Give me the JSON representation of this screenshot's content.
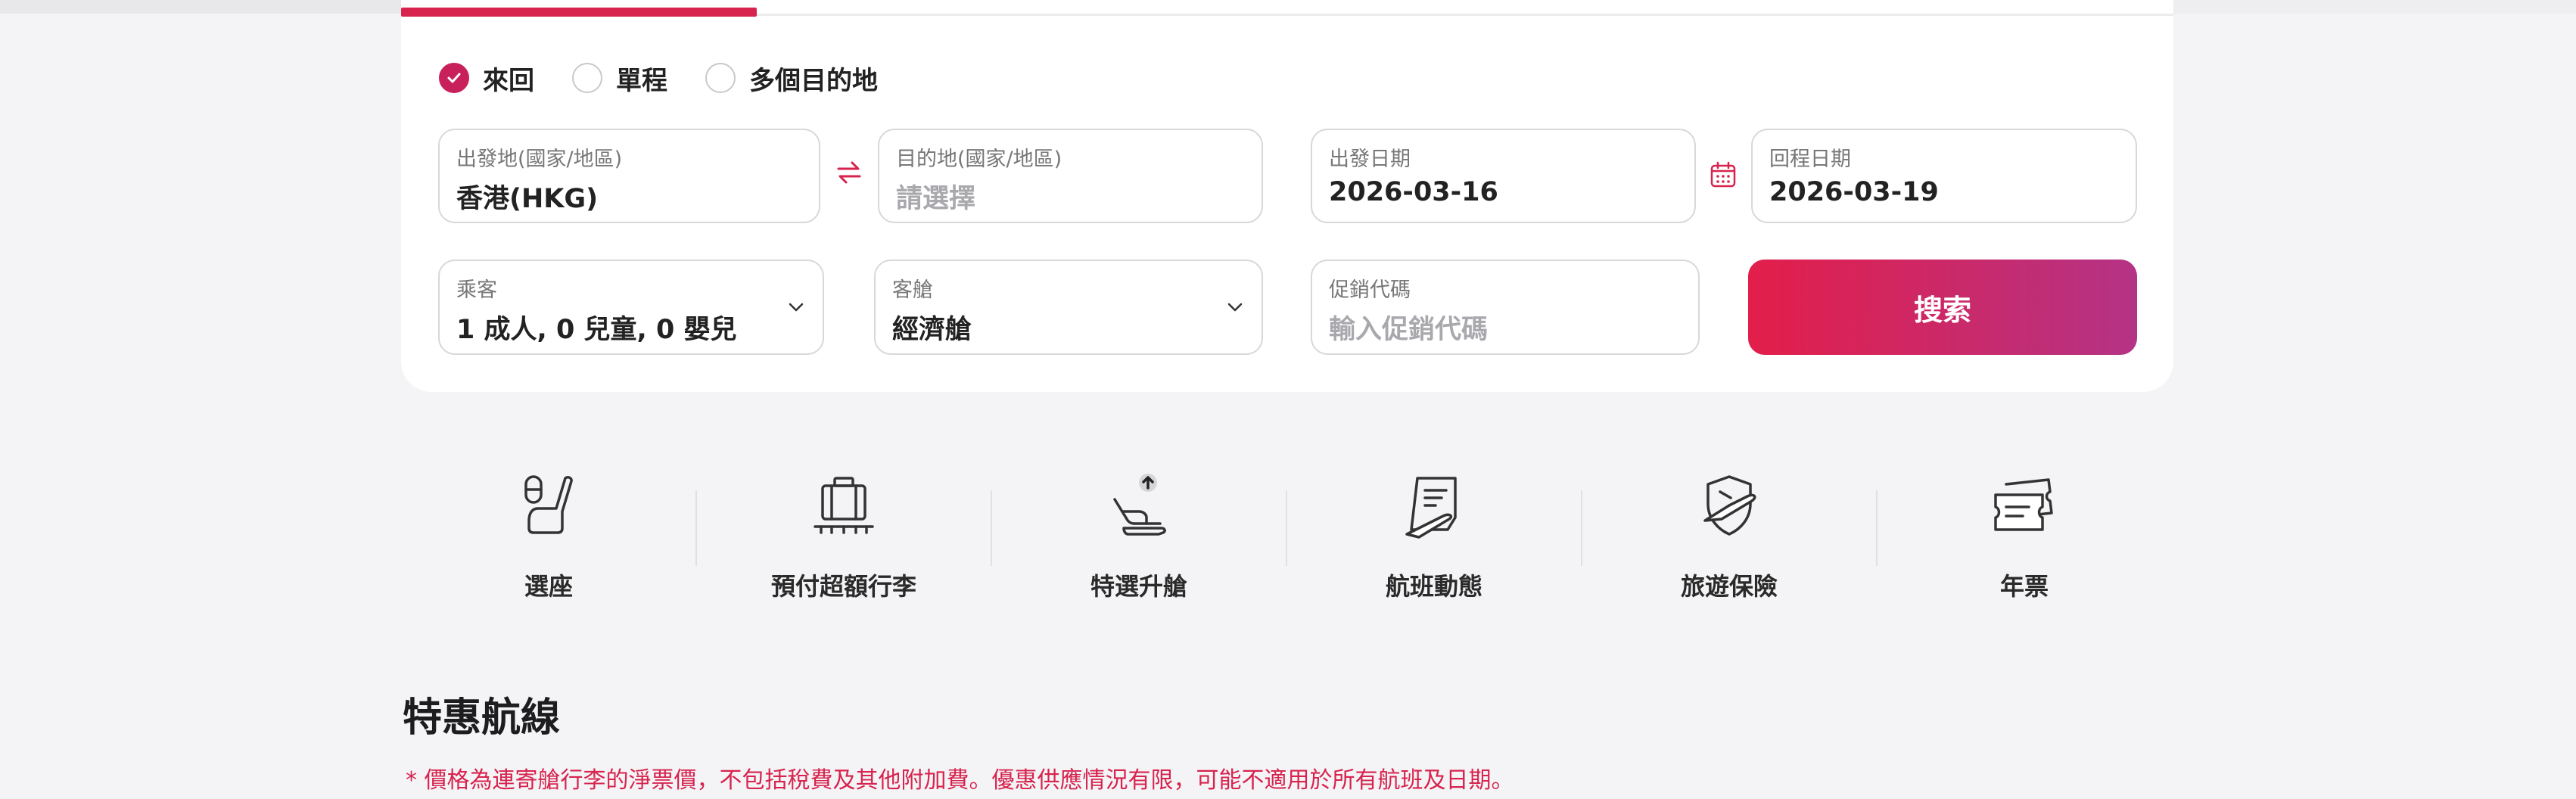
{
  "trip_types": [
    {
      "label": "來回",
      "checked": true
    },
    {
      "label": "單程",
      "checked": false
    },
    {
      "label": "多個目的地",
      "checked": false
    }
  ],
  "origin": {
    "label": "出發地(國家/地區)",
    "value": "香港(HKG)"
  },
  "destination": {
    "label": "目的地(國家/地區)",
    "placeholder": "請選擇"
  },
  "depart_date": {
    "label": "出發日期",
    "value": "2026-03-16"
  },
  "return_date": {
    "label": "回程日期",
    "value": "2026-03-19"
  },
  "passengers": {
    "label": "乘客",
    "value": "1 成人, 0 兒童, 0 嬰兒"
  },
  "cabin": {
    "label": "客艙",
    "value": "經濟艙"
  },
  "promo": {
    "label": "促銷代碼",
    "placeholder": "輸入促銷代碼"
  },
  "search_label": "搜索",
  "services": [
    {
      "label": "選座",
      "icon": "seat-icon"
    },
    {
      "label": "預付超額行李",
      "icon": "baggage-icon"
    },
    {
      "label": "特選升艙",
      "icon": "upgrade-seat-icon"
    },
    {
      "label": "航班動態",
      "icon": "flight-status-icon"
    },
    {
      "label": "旅遊保險",
      "icon": "travel-insurance-icon"
    },
    {
      "label": "年票",
      "icon": "annual-pass-icon"
    }
  ],
  "section_title": "特惠航線",
  "disclaimer": "* 價格為連寄艙行李的淨票價，不包括稅費及其他附加費。優惠供應情況有限，可能不適用於所有航班及日期。",
  "colors": {
    "accent": "#d7234e",
    "accent_end": "#b43385",
    "background": "#f4f4f6"
  }
}
